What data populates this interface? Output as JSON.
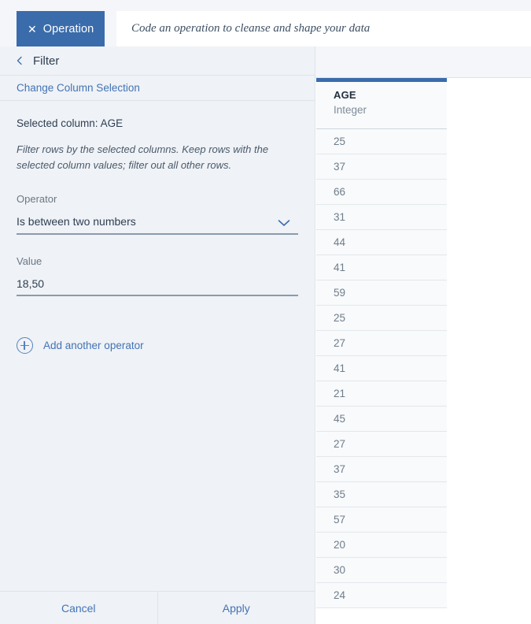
{
  "tab": {
    "close_icon": "close-icon",
    "label": "Operation"
  },
  "code_bar": {
    "placeholder": "Code an operation to cleanse and shape your data"
  },
  "panel": {
    "back_icon": "chevron-left-icon",
    "title": "Filter",
    "change_column_link": "Change Column Selection",
    "selected_column": "Selected column: AGE",
    "description": "Filter rows by the selected columns. Keep rows with the selected column values; filter out all other rows.",
    "operator": {
      "label": "Operator",
      "value": "Is between two numbers",
      "chevron_icon": "chevron-down-icon"
    },
    "value_field": {
      "label": "Value",
      "value": "18,50",
      "placeholder": ""
    },
    "add_operator": {
      "icon": "plus-circle-icon",
      "label": "Add another operator"
    },
    "footer": {
      "cancel_label": "Cancel",
      "apply_label": "Apply"
    }
  },
  "table": {
    "column": {
      "name": "AGE",
      "type": "Integer",
      "selected": true,
      "accent_color": "#3a6cac"
    },
    "rows": [
      "25",
      "37",
      "66",
      "31",
      "44",
      "41",
      "59",
      "25",
      "27",
      "41",
      "21",
      "45",
      "27",
      "37",
      "35",
      "57",
      "20",
      "30",
      "24"
    ]
  },
  "colors": {
    "brand_blue": "#3a6cac",
    "link_blue": "#4273b5",
    "panel_bg": "#eff2f6",
    "chrome_bg": "#f4f6fa"
  }
}
